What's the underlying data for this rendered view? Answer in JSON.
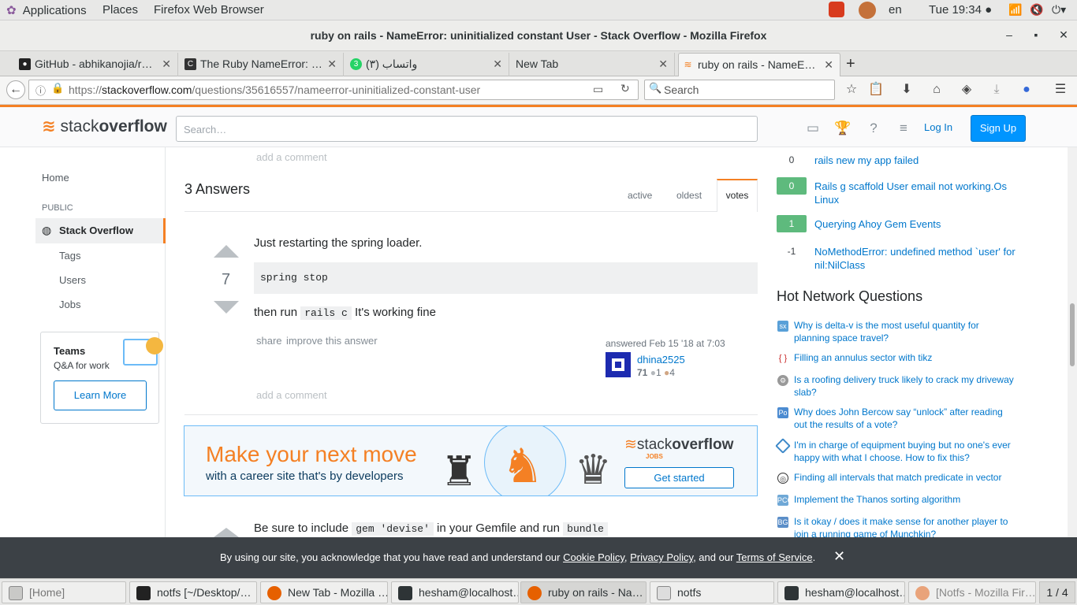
{
  "topbar": {
    "applications": "Applications",
    "places": "Places",
    "app_name": "Firefox Web Browser",
    "lang": "en",
    "clock": "Tue 19:34 ●"
  },
  "window": {
    "title": "ruby on rails - NameError: uninitialized constant User - Stack Overflow - Mozilla Firefox"
  },
  "tabs": [
    {
      "label": "GitHub - abhikanojia/r…"
    },
    {
      "label": "The Ruby NameError: …"
    },
    {
      "label": "واتساب (٣)",
      "badge": "3"
    },
    {
      "label": "New Tab"
    },
    {
      "label": "ruby on rails - NameE…"
    }
  ],
  "nav": {
    "url_prefix": "https://",
    "url_host": "stackoverflow.com",
    "url_path": "/questions/35616557/nameerror-uninitialized-constant-user",
    "search_placeholder": "Search"
  },
  "so_header": {
    "logo_plain": "stack",
    "logo_bold": "overflow",
    "search_placeholder": "Search…",
    "login": "Log In",
    "signup": "Sign Up"
  },
  "leftnav": {
    "home": "Home",
    "public": "PUBLIC",
    "stack_overflow": "Stack Overflow",
    "tags": "Tags",
    "users": "Users",
    "jobs": "Jobs",
    "teams_title": "Teams",
    "teams_sub": "Q&A for work",
    "learn_more": "Learn More"
  },
  "main": {
    "add_comment_top": "add a comment",
    "answers_count": "3 Answers",
    "sort_tabs": [
      "active",
      "oldest",
      "votes"
    ],
    "answer1": {
      "votes": "7",
      "text1": "Just restarting the spring loader.",
      "code": "spring stop",
      "then_run": "then run",
      "inline_code": "rails c",
      "after_code": "It's working fine",
      "share": "share",
      "improve": "improve this answer",
      "answered": "answered Feb 15 '18 at 7:03",
      "user": "dhina2525",
      "rep": "71",
      "silver": "1",
      "bronze": "4",
      "add_comment": "add a comment"
    },
    "ad": {
      "headline": "Make your next move",
      "subline": "with a career site that's by developers",
      "brand_plain": "stack",
      "brand_bold": "overflow",
      "brand_jobs": "JOBS",
      "cta": "Get started"
    },
    "answer2": {
      "prefix": "Be sure to include",
      "code1": "gem 'devise'",
      "middle": "in your Gemfile and run",
      "code2": "bundle"
    }
  },
  "related": [
    {
      "votes": "0",
      "answered": false,
      "title": "rails new my app failed"
    },
    {
      "votes": "0",
      "answered": true,
      "title": "Rails g scaffold User email not working.Os Linux"
    },
    {
      "votes": "1",
      "answered": true,
      "title": "Querying Ahoy Gem Events"
    },
    {
      "votes": "-1",
      "answered": false,
      "title": "NoMethodError: undefined method `user' for nil:NilClass"
    }
  ],
  "hot_network": {
    "heading": "Hot Network Questions",
    "items": [
      {
        "title": "Why is delta-v is the most useful quantity for planning space travel?",
        "icon": "space-exploration-icon",
        "color": "#59a0d8"
      },
      {
        "title": "Filling an annulus sector with tikz",
        "icon": "tex-icon",
        "color": "#c92b2b"
      },
      {
        "title": "Is a roofing delivery truck likely to crack my driveway slab?",
        "icon": "diy-icon",
        "color": "#777777"
      },
      {
        "title": "Why does John Bercow say “unlock” after reading out the results of a vote?",
        "icon": "politics-icon",
        "color": "#4c8bd1"
      },
      {
        "title": "I'm in charge of equipment buying but no one's ever happy with what I choose. How to fix this?",
        "icon": "workplace-icon",
        "color": "#3d89c9"
      },
      {
        "title": "Finding all intervals that match predicate in vector",
        "icon": "codereview-icon",
        "color": "#333333"
      },
      {
        "title": "Implement the Thanos sorting algorithm",
        "icon": "codegolf-icon",
        "color": "#6fa8d6"
      },
      {
        "title": "Is it okay / does it make sense for another player to join a running game of Munchkin?",
        "icon": "boardgames-icon",
        "color": "#5b8ec8"
      }
    ]
  },
  "cookie": {
    "text_before": "By using our site, you acknowledge that you have read and understand our",
    "cookie_policy": "Cookie Policy",
    "comma": ",",
    "privacy_policy": "Privacy Policy",
    "and_our": ", and our",
    "terms": "Terms of Service",
    "period": "."
  },
  "taskbar": {
    "items": [
      {
        "label": "[Home]"
      },
      {
        "label": "notfs [~/Desktop/…"
      },
      {
        "label": "New Tab - Mozilla …"
      },
      {
        "label": "hesham@localhost…"
      },
      {
        "label": "ruby on rails - Na…"
      },
      {
        "label": "notfs"
      },
      {
        "label": "hesham@localhost…"
      },
      {
        "label": "[Notfs - Mozilla Fir…"
      }
    ],
    "workspace": "1 / 4"
  },
  "colors": {
    "so_orange": "#f48024",
    "so_blue": "#0077cc",
    "accepted_green": "#5eba7d"
  }
}
